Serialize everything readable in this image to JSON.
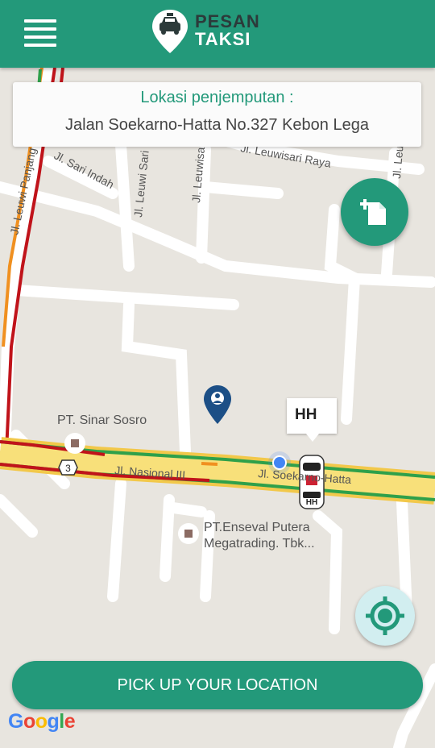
{
  "header": {
    "logo_line1": "PESAN",
    "logo_line2": "TAKSI",
    "colors": {
      "brand": "#23997a",
      "logo_dark": "#2c3a3a"
    }
  },
  "pickup": {
    "title": "Lokasi penjemputan :",
    "address": "Jalan Soekarno-Hatta No.327 Kebon Lega"
  },
  "map": {
    "street_labels": [
      "Jl. Leuwi Panjang",
      "Jl. Sari Indah",
      "Jl. Leuwi Sari",
      "Jl. Leuwisari",
      "Jl. Leuwisari Raya",
      "Jl. Leuwi Sari X",
      "Jl. Nasional III",
      "Jl. Soekarno-Hatta"
    ],
    "route_shield": "3",
    "poi": [
      {
        "name": "PT. Sinar Sosro"
      },
      {
        "name_line1": "PT.Enseval Putera",
        "name_line2": "Megatrading. Tbk..."
      }
    ],
    "taxi_label": "HH",
    "attribution": "Google"
  },
  "actions": {
    "add_icon": "add-document-icon",
    "locate_icon": "crosshair-icon",
    "cta_label": "PICK UP YOUR LOCATION"
  }
}
